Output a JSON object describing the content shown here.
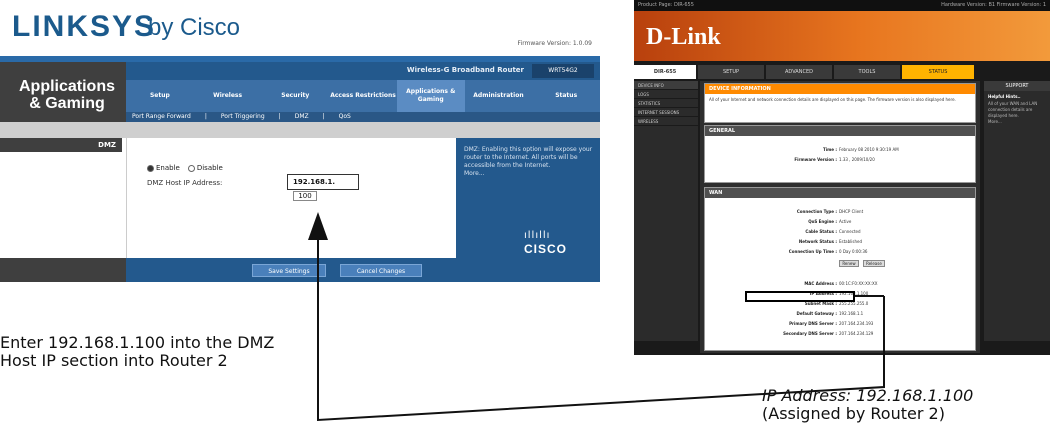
{
  "linksys": {
    "logo": "LINKSYS",
    "logo_sub": "by Cisco",
    "firmware": "Firmware Version: 1.0.09",
    "section_title": "Applications & Gaming",
    "product_name": "Wireless-G Broadband Router",
    "model": "WRT54G2",
    "tabs": [
      "Setup",
      "Wireless",
      "Security",
      "Access Restrictions",
      "Applications & Gaming",
      "Administration",
      "Status"
    ],
    "subtabs": [
      "Port Range Forward",
      "|",
      "Port Triggering",
      "|",
      "DMZ",
      "|",
      "QoS"
    ],
    "row_label": "DMZ",
    "enable_label": "Enable",
    "disable_label": "Disable",
    "dmz_host_label": "DMZ Host IP Address:",
    "ip_prefix": "192.168.1.",
    "ip_last_octet": "100",
    "help_text": "DMZ: Enabling this option will expose your router to the Internet. All ports will be accessible from the Internet.",
    "help_more": "More...",
    "cisco": "CISCO",
    "save_label": "Save Settings",
    "cancel_label": "Cancel Changes"
  },
  "dlink": {
    "topbar_left": "Product Page: DIR-655",
    "topbar_right": "Hardware Version: B1   Firmware Version: 1",
    "logo": "D-Link",
    "model_tab": "DIR-655",
    "tabs": [
      "SETUP",
      "ADVANCED",
      "TOOLS",
      "STATUS",
      "SUPPORT"
    ],
    "left_items": [
      "DEVICE INFO",
      "LOGS",
      "STATISTICS",
      "INTERNET SESSIONS",
      "WIRELESS"
    ],
    "info_head": "DEVICE INFORMATION",
    "info_text": "All of your Internet and network connection details are displayed on this page. The firmware version is also displayed here.",
    "general_head": "GENERAL",
    "general_rows": [
      {
        "key": "Time :",
        "value": "February 08 2010 9:30:19 AM"
      },
      {
        "key": "Firmware Version :",
        "value": "1.33 , 2009/10/20"
      }
    ],
    "wan_head": "WAN",
    "wan_rows": [
      {
        "key": "Connection Type :",
        "value": "DHCP Client"
      },
      {
        "key": "QoS Engine :",
        "value": "Active"
      },
      {
        "key": "Cable Status :",
        "value": "Connected"
      },
      {
        "key": "Network Status :",
        "value": "Established"
      },
      {
        "key": "Connection Up Time :",
        "value": "0 Day 0:00:36"
      }
    ],
    "renew_label": "Renew",
    "release_label": "Release",
    "wan_rows2": [
      {
        "key": "MAC Address :",
        "value": "00:1C:F0:XX:XX:XX"
      },
      {
        "key": "IP Address :",
        "value": "192.168.1.100"
      },
      {
        "key": "Subnet Mask :",
        "value": "255.255.255.0"
      },
      {
        "key": "Default Gateway :",
        "value": "192.168.1.1"
      },
      {
        "key": "Primary DNS Server :",
        "value": "207.164.234.193"
      },
      {
        "key": "Secondary DNS Server :",
        "value": "207.164.234.129"
      }
    ],
    "support_tab": "SUPPORT",
    "hints_title": "Helpful Hints..",
    "hints_text": "All of your WAN and LAN connection details are displayed here.",
    "hints_more": "More..."
  },
  "annotations": {
    "left_line1": "Enter 192.168.1.100 into the DMZ",
    "left_line2": "Host IP section into Router 2",
    "right_line1": "IP Address: 192.168.1.100",
    "right_line2": "(Assigned by Router 2)"
  }
}
